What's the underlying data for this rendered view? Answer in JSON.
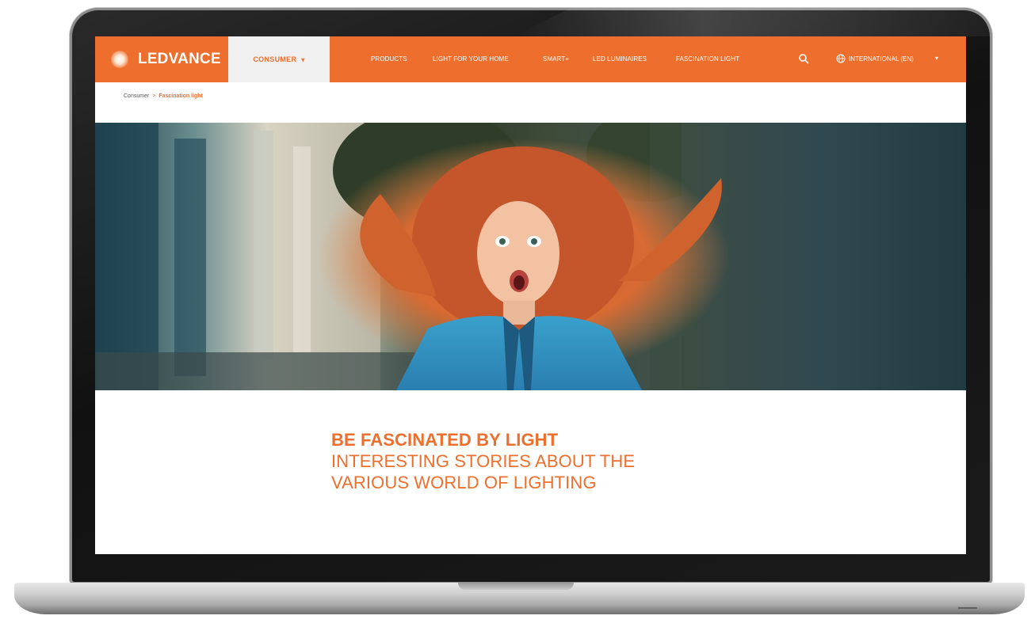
{
  "brand": {
    "name": "LEDVANCE",
    "accent": "#ee6f2d"
  },
  "header": {
    "active_tab": "CONSUMER",
    "nav": [
      "PRODUCTS",
      "LIGHT FOR YOUR HOME",
      "SMART+",
      "LED LUMINAIRES",
      "FASCINATION LIGHT"
    ],
    "language": "INTERNATIONAL (EN)",
    "icons": {
      "search": "search-icon",
      "language": "globe-icon",
      "dropdown": "chevron-down-icon",
      "logo": "sun-logo-icon"
    }
  },
  "breadcrumb": {
    "home": "Consumer",
    "separator": ">",
    "current": "Fascination light"
  },
  "hero": {
    "description_icon": "hero-image"
  },
  "headline": {
    "title": "BE FASCINATED BY LIGHT",
    "line1": "INTERESTING STORIES ABOUT THE",
    "line2": "VARIOUS WORLD OF LIGHTING"
  }
}
